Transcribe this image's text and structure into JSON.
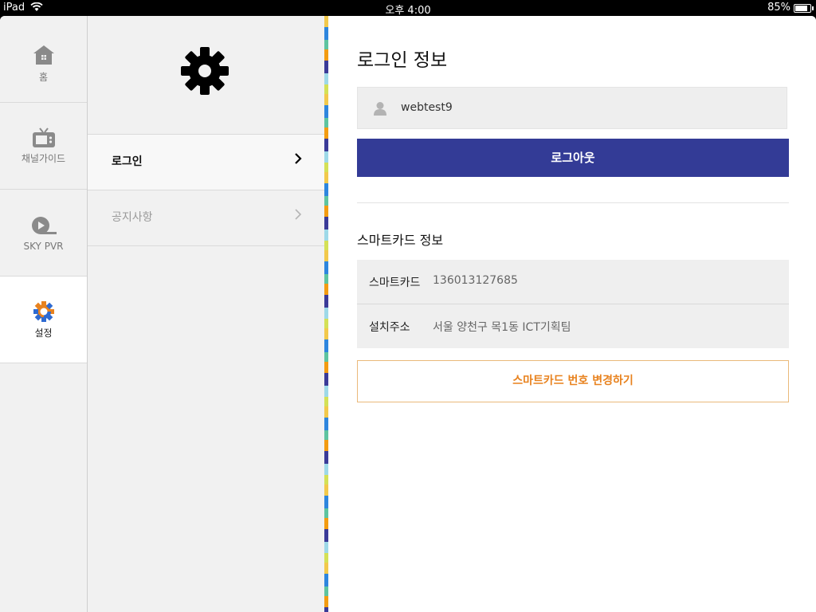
{
  "status_bar": {
    "device": "iPad",
    "time": "오후 4:00",
    "battery": "85%"
  },
  "nav": {
    "items": [
      {
        "label": "홈",
        "icon": "home-icon"
      },
      {
        "label": "채널가이드",
        "icon": "tv-icon"
      },
      {
        "label": "SKY PVR",
        "icon": "pvr-icon"
      },
      {
        "label": "설정",
        "icon": "settings-icon"
      }
    ],
    "active": "설정"
  },
  "submenu": {
    "header_icon": "gear-icon",
    "items": [
      {
        "label": "로그인",
        "active": true
      },
      {
        "label": "공지사항",
        "active": false
      }
    ]
  },
  "login": {
    "title": "로그인 정보",
    "username": "webtest9",
    "logout_label": "로그아웃"
  },
  "smartcard": {
    "title": "스마트카드 정보",
    "rows": [
      {
        "key": "스마트카드",
        "value": "136013127685"
      },
      {
        "key": "설치주소",
        "value": "서울 양천구 목1동 ICT기획팀"
      }
    ],
    "change_label": "스마트카드 번호 변경하기"
  },
  "colors": {
    "primary_button": "#333b96",
    "accent_orange": "#e8821e",
    "nav_bg": "#f1f1f1"
  }
}
